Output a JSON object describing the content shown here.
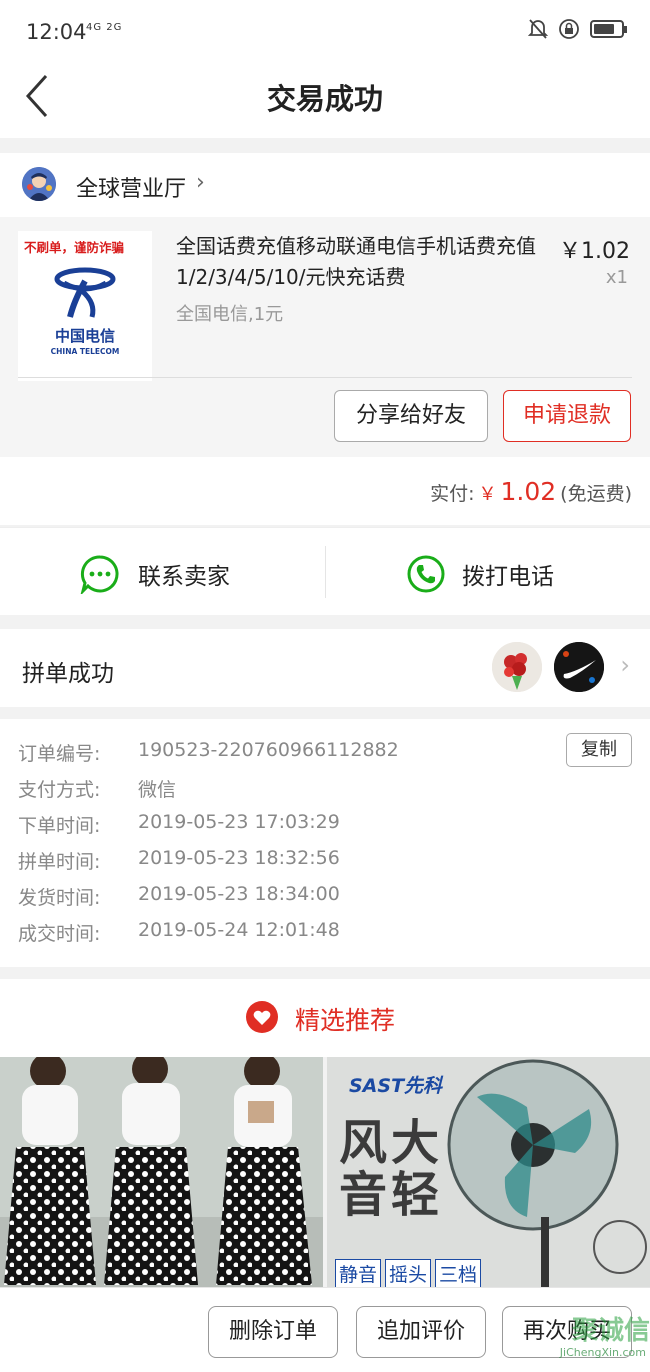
{
  "status": {
    "time": "12:04",
    "network": "4G 2G"
  },
  "nav": {
    "title": "交易成功"
  },
  "shop": {
    "name": "全球营业厅"
  },
  "product": {
    "badge_warning": "不刷单，谨防诈骗",
    "brand_cn": "中国电信",
    "brand_en": "CHINA TELECOM",
    "title": "全国话费充值移动联通电信手机话费充值1/2/3/4/5/10/元快充话费",
    "spec": "全国电信,1元",
    "price": "￥1.02",
    "qty": "x1",
    "share_label": "分享给好友",
    "refund_label": "申请退款"
  },
  "payment": {
    "label": "实付:",
    "currency": "￥",
    "amount": "1.02",
    "shipping": "(免运费)"
  },
  "contact": {
    "seller_label": "联系卖家",
    "call_label": "拨打电话"
  },
  "group": {
    "label": "拼单成功"
  },
  "order_info": {
    "copy_label": "复制",
    "rows": [
      {
        "key": "订单编号:",
        "value": "190523-220760966112882"
      },
      {
        "key": "支付方式:",
        "value": "微信"
      },
      {
        "key": "下单时间:",
        "value": "2019-05-23 17:03:29"
      },
      {
        "key": "拼单时间:",
        "value": "2019-05-23 18:32:56"
      },
      {
        "key": "发货时间:",
        "value": "2019-05-23 18:34:00"
      },
      {
        "key": "成交时间:",
        "value": "2019-05-24 12:01:48"
      }
    ]
  },
  "recommend": {
    "title": "精选推荐",
    "fan_brand": "SAST先科",
    "fan_slogan": "风大音轻",
    "fan_tags": [
      "静音",
      "摇头",
      "三档"
    ]
  },
  "bottom": {
    "delete_label": "删除订单",
    "review_label": "追加评价",
    "rebuy_label": "再次购买"
  },
  "watermark": {
    "text": "聚诚信",
    "url": "JiChengXin.com"
  },
  "colors": {
    "accent": "#e02e24",
    "green": "#1aad19"
  }
}
